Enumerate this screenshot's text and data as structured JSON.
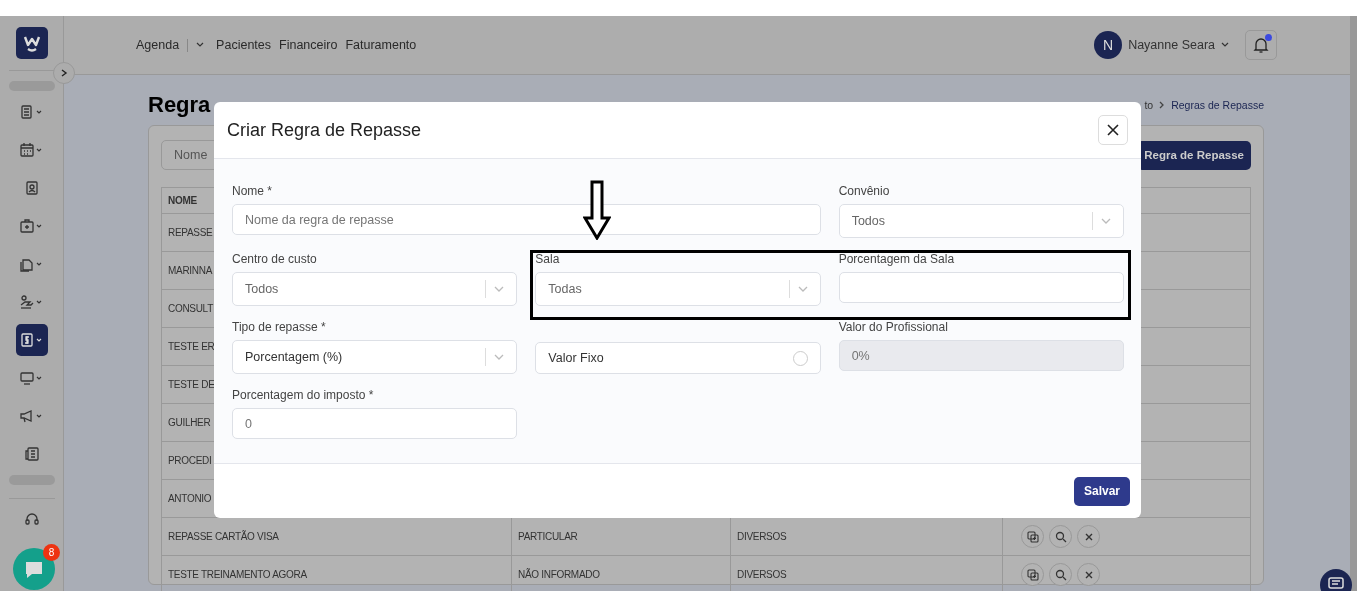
{
  "nav": {
    "items": [
      "Agenda",
      "Pacientes",
      "Financeiro",
      "Faturamento"
    ]
  },
  "user": {
    "initial": "N",
    "name": "Nayanne Seara",
    "notification": true
  },
  "sidebar": {
    "items": [
      {
        "kind": "notebook",
        "selected": false
      },
      {
        "kind": "calendar",
        "selected": false
      },
      {
        "kind": "badge",
        "selected": false
      },
      {
        "kind": "kit",
        "selected": false
      },
      {
        "kind": "files",
        "selected": false
      },
      {
        "kind": "hand",
        "selected": false
      },
      {
        "kind": "money",
        "selected": true
      },
      {
        "kind": "monitor",
        "selected": false
      },
      {
        "kind": "megaphone",
        "selected": false
      },
      {
        "kind": "news",
        "selected": false
      }
    ]
  },
  "chat": {
    "badge": "8"
  },
  "page": {
    "title": "Regra",
    "breadcrumb": [
      "to",
      "Regras de Repasse"
    ],
    "filter_placeholder": "Nome",
    "new_button": "Regra de Repasse"
  },
  "table": {
    "columns": [
      "NOME"
    ],
    "rows": [
      {
        "cells": [
          "REPASSE"
        ]
      },
      {
        "cells": [
          "MARINNA"
        ]
      },
      {
        "cells": [
          "CONSULT"
        ]
      },
      {
        "cells": [
          "TESTE ER"
        ]
      },
      {
        "cells": [
          "TESTE DE"
        ]
      },
      {
        "cells": [
          "GUILHER"
        ]
      },
      {
        "cells": [
          "PROCEDI"
        ]
      },
      {
        "cells": [
          "ANTONIO"
        ]
      },
      {
        "cells": [
          "REPASSE CARTÃO VISA",
          "PARTICULAR",
          "DIVERSOS"
        ]
      },
      {
        "cells": [
          "TESTE TREINAMENTO AGORA",
          "NÃO INFORMADO",
          "DIVERSOS"
        ]
      }
    ]
  },
  "modal": {
    "title": "Criar Regra de Repasse",
    "fields": [
      {
        "kind": "text",
        "label": "Nome *",
        "placeholder": "Nome da regra de repasse"
      },
      {
        "kind": "select",
        "label": "Convênio",
        "placeholder": "Todos"
      },
      {
        "kind": "select",
        "label": "Centro de custo",
        "placeholder": "Todos"
      },
      {
        "kind": "select",
        "label": "Sala",
        "placeholder": "Todas"
      },
      {
        "kind": "text",
        "label": "Porcentagem da Sala"
      },
      {
        "kind": "select",
        "label": "Tipo de repasse *",
        "value": "Porcentagem (%)"
      },
      {
        "kind": "toggle",
        "label": "Valor Fixo",
        "checked": false
      },
      {
        "kind": "disabled",
        "label": "Valor do Profissional",
        "placeholder": "0%"
      },
      {
        "kind": "text",
        "label": "Porcentagem do imposto *",
        "placeholder": "0"
      }
    ],
    "save_button": "Salvar"
  }
}
